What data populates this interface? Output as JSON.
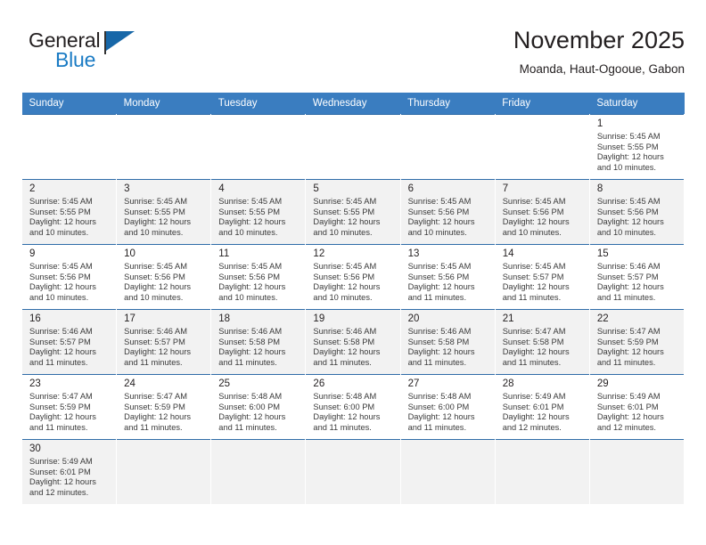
{
  "brand": {
    "name_part1": "General",
    "name_part2": "Blue",
    "flag_icon": "blue-flag-triangle-icon"
  },
  "header": {
    "title": "November 2025",
    "subtitle": "Moanda, Haut-Ogooue, Gabon"
  },
  "colors": {
    "header_bar": "#3a7dc0",
    "brand_blue": "#1a7bc4",
    "row_divider": "#2f6ca8",
    "shaded_row": "#f2f2f2",
    "text": "#231f20"
  },
  "weekdays": [
    "Sunday",
    "Monday",
    "Tuesday",
    "Wednesday",
    "Thursday",
    "Friday",
    "Saturday"
  ],
  "labels": {
    "sunrise": "Sunrise:",
    "sunset": "Sunset:",
    "daylight": "Daylight:"
  },
  "weeks": [
    [
      {
        "day": "",
        "empty": true
      },
      {
        "day": "",
        "empty": true
      },
      {
        "day": "",
        "empty": true
      },
      {
        "day": "",
        "empty": true
      },
      {
        "day": "",
        "empty": true
      },
      {
        "day": "",
        "empty": true
      },
      {
        "day": "1",
        "sunrise": "Sunrise: 5:45 AM",
        "sunset": "Sunset: 5:55 PM",
        "daylight1": "Daylight: 12 hours",
        "daylight2": "and 10 minutes."
      }
    ],
    [
      {
        "day": "2",
        "sunrise": "Sunrise: 5:45 AM",
        "sunset": "Sunset: 5:55 PM",
        "daylight1": "Daylight: 12 hours",
        "daylight2": "and 10 minutes."
      },
      {
        "day": "3",
        "sunrise": "Sunrise: 5:45 AM",
        "sunset": "Sunset: 5:55 PM",
        "daylight1": "Daylight: 12 hours",
        "daylight2": "and 10 minutes."
      },
      {
        "day": "4",
        "sunrise": "Sunrise: 5:45 AM",
        "sunset": "Sunset: 5:55 PM",
        "daylight1": "Daylight: 12 hours",
        "daylight2": "and 10 minutes."
      },
      {
        "day": "5",
        "sunrise": "Sunrise: 5:45 AM",
        "sunset": "Sunset: 5:55 PM",
        "daylight1": "Daylight: 12 hours",
        "daylight2": "and 10 minutes."
      },
      {
        "day": "6",
        "sunrise": "Sunrise: 5:45 AM",
        "sunset": "Sunset: 5:56 PM",
        "daylight1": "Daylight: 12 hours",
        "daylight2": "and 10 minutes."
      },
      {
        "day": "7",
        "sunrise": "Sunrise: 5:45 AM",
        "sunset": "Sunset: 5:56 PM",
        "daylight1": "Daylight: 12 hours",
        "daylight2": "and 10 minutes."
      },
      {
        "day": "8",
        "sunrise": "Sunrise: 5:45 AM",
        "sunset": "Sunset: 5:56 PM",
        "daylight1": "Daylight: 12 hours",
        "daylight2": "and 10 minutes."
      }
    ],
    [
      {
        "day": "9",
        "sunrise": "Sunrise: 5:45 AM",
        "sunset": "Sunset: 5:56 PM",
        "daylight1": "Daylight: 12 hours",
        "daylight2": "and 10 minutes."
      },
      {
        "day": "10",
        "sunrise": "Sunrise: 5:45 AM",
        "sunset": "Sunset: 5:56 PM",
        "daylight1": "Daylight: 12 hours",
        "daylight2": "and 10 minutes."
      },
      {
        "day": "11",
        "sunrise": "Sunrise: 5:45 AM",
        "sunset": "Sunset: 5:56 PM",
        "daylight1": "Daylight: 12 hours",
        "daylight2": "and 10 minutes."
      },
      {
        "day": "12",
        "sunrise": "Sunrise: 5:45 AM",
        "sunset": "Sunset: 5:56 PM",
        "daylight1": "Daylight: 12 hours",
        "daylight2": "and 10 minutes."
      },
      {
        "day": "13",
        "sunrise": "Sunrise: 5:45 AM",
        "sunset": "Sunset: 5:56 PM",
        "daylight1": "Daylight: 12 hours",
        "daylight2": "and 11 minutes."
      },
      {
        "day": "14",
        "sunrise": "Sunrise: 5:45 AM",
        "sunset": "Sunset: 5:57 PM",
        "daylight1": "Daylight: 12 hours",
        "daylight2": "and 11 minutes."
      },
      {
        "day": "15",
        "sunrise": "Sunrise: 5:46 AM",
        "sunset": "Sunset: 5:57 PM",
        "daylight1": "Daylight: 12 hours",
        "daylight2": "and 11 minutes."
      }
    ],
    [
      {
        "day": "16",
        "sunrise": "Sunrise: 5:46 AM",
        "sunset": "Sunset: 5:57 PM",
        "daylight1": "Daylight: 12 hours",
        "daylight2": "and 11 minutes."
      },
      {
        "day": "17",
        "sunrise": "Sunrise: 5:46 AM",
        "sunset": "Sunset: 5:57 PM",
        "daylight1": "Daylight: 12 hours",
        "daylight2": "and 11 minutes."
      },
      {
        "day": "18",
        "sunrise": "Sunrise: 5:46 AM",
        "sunset": "Sunset: 5:58 PM",
        "daylight1": "Daylight: 12 hours",
        "daylight2": "and 11 minutes."
      },
      {
        "day": "19",
        "sunrise": "Sunrise: 5:46 AM",
        "sunset": "Sunset: 5:58 PM",
        "daylight1": "Daylight: 12 hours",
        "daylight2": "and 11 minutes."
      },
      {
        "day": "20",
        "sunrise": "Sunrise: 5:46 AM",
        "sunset": "Sunset: 5:58 PM",
        "daylight1": "Daylight: 12 hours",
        "daylight2": "and 11 minutes."
      },
      {
        "day": "21",
        "sunrise": "Sunrise: 5:47 AM",
        "sunset": "Sunset: 5:58 PM",
        "daylight1": "Daylight: 12 hours",
        "daylight2": "and 11 minutes."
      },
      {
        "day": "22",
        "sunrise": "Sunrise: 5:47 AM",
        "sunset": "Sunset: 5:59 PM",
        "daylight1": "Daylight: 12 hours",
        "daylight2": "and 11 minutes."
      }
    ],
    [
      {
        "day": "23",
        "sunrise": "Sunrise: 5:47 AM",
        "sunset": "Sunset: 5:59 PM",
        "daylight1": "Daylight: 12 hours",
        "daylight2": "and 11 minutes."
      },
      {
        "day": "24",
        "sunrise": "Sunrise: 5:47 AM",
        "sunset": "Sunset: 5:59 PM",
        "daylight1": "Daylight: 12 hours",
        "daylight2": "and 11 minutes."
      },
      {
        "day": "25",
        "sunrise": "Sunrise: 5:48 AM",
        "sunset": "Sunset: 6:00 PM",
        "daylight1": "Daylight: 12 hours",
        "daylight2": "and 11 minutes."
      },
      {
        "day": "26",
        "sunrise": "Sunrise: 5:48 AM",
        "sunset": "Sunset: 6:00 PM",
        "daylight1": "Daylight: 12 hours",
        "daylight2": "and 11 minutes."
      },
      {
        "day": "27",
        "sunrise": "Sunrise: 5:48 AM",
        "sunset": "Sunset: 6:00 PM",
        "daylight1": "Daylight: 12 hours",
        "daylight2": "and 11 minutes."
      },
      {
        "day": "28",
        "sunrise": "Sunrise: 5:49 AM",
        "sunset": "Sunset: 6:01 PM",
        "daylight1": "Daylight: 12 hours",
        "daylight2": "and 12 minutes."
      },
      {
        "day": "29",
        "sunrise": "Sunrise: 5:49 AM",
        "sunset": "Sunset: 6:01 PM",
        "daylight1": "Daylight: 12 hours",
        "daylight2": "and 12 minutes."
      }
    ],
    [
      {
        "day": "30",
        "sunrise": "Sunrise: 5:49 AM",
        "sunset": "Sunset: 6:01 PM",
        "daylight1": "Daylight: 12 hours",
        "daylight2": "and 12 minutes."
      },
      {
        "day": "",
        "empty": true
      },
      {
        "day": "",
        "empty": true
      },
      {
        "day": "",
        "empty": true
      },
      {
        "day": "",
        "empty": true
      },
      {
        "day": "",
        "empty": true
      },
      {
        "day": "",
        "empty": true
      }
    ]
  ]
}
